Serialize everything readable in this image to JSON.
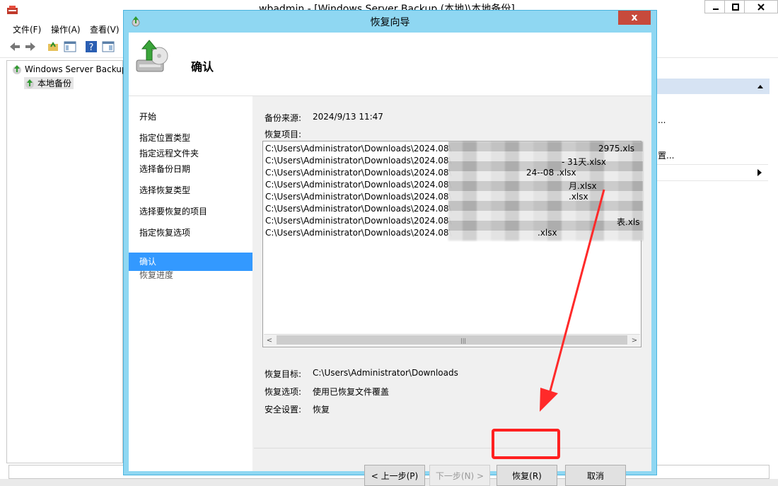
{
  "window": {
    "title": "wbadmin - [Windows Server Backup (本地)\\本地备份]",
    "menu": [
      "文件(F)",
      "操作(A)",
      "查看(V)"
    ]
  },
  "tree": {
    "root": "Windows Server Backup",
    "child": "本地备份"
  },
  "right_pane": {
    "items": [
      "...",
      "置..."
    ]
  },
  "dialog": {
    "title": "恢复向导",
    "close_label": "x",
    "header_title": "确认",
    "steps": [
      "开始",
      "指定位置类型",
      "指定远程文件夹",
      "选择备份日期",
      "选择恢复类型",
      "选择要恢复的项目",
      "指定恢复选项",
      "确认",
      "恢复进度"
    ],
    "backup_source_label": "备份来源:",
    "backup_source_value": "2024/9/13 11:47",
    "items_label": "恢复项目:",
    "items": [
      "C:\\Users\\Administrator\\Downloads\\2024.08\\",
      "C:\\Users\\Administrator\\Downloads\\2024.08\\",
      "C:\\Users\\Administrator\\Downloads\\2024.08\\",
      "C:\\Users\\Administrator\\Downloads\\2024.08\\",
      "C:\\Users\\Administrator\\Downloads\\2024.08\\",
      "C:\\Users\\Administrator\\Downloads\\2024.08\\",
      "C:\\Users\\Administrator\\Downloads\\2024.08\\",
      "C:\\Users\\Administrator\\Downloads\\2024.08\\"
    ],
    "item_suffixes": [
      "2975.xls",
      "- 31天.xlsx",
      "24--08 .xlsx",
      "月.xlsx",
      ".xlsx",
      "",
      "表.xls",
      ".xlsx"
    ],
    "target_label": "恢复目标:",
    "target_value": "C:\\Users\\Administrator\\Downloads",
    "option_label": "恢复选项:",
    "option_value": "使用已恢复文件覆盖",
    "security_label": "安全设置:",
    "security_value": "恢复",
    "buttons": {
      "prev": "< 上一步(P)",
      "next": "下一步(N) >",
      "recover": "恢复(R)",
      "cancel": "取消"
    }
  },
  "colors": {
    "dialog_frame": "#8fd7f2",
    "selected_step": "#3399ff",
    "highlight": "#ff2020",
    "close_button": "#c74a3c"
  }
}
